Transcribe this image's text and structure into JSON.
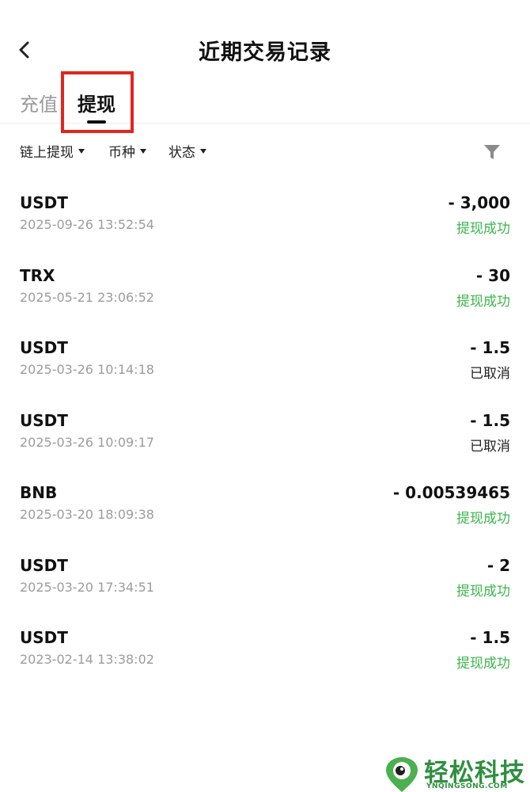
{
  "header": {
    "title": "近期交易记录"
  },
  "tabs": [
    {
      "label": "充值"
    },
    {
      "label": "提现"
    }
  ],
  "filters": [
    {
      "label": "链上提现"
    },
    {
      "label": "币种"
    },
    {
      "label": "状态"
    }
  ],
  "records": [
    {
      "coin": "USDT",
      "time": "2025-09-26 13:52:54",
      "amount": "- 3,000",
      "status": "提现成功"
    },
    {
      "coin": "TRX",
      "time": "2025-05-21 23:06:52",
      "amount": "- 30",
      "status": "提现成功"
    },
    {
      "coin": "USDT",
      "time": "2025-03-26 10:14:18",
      "amount": "- 1.5",
      "status": "已取消"
    },
    {
      "coin": "USDT",
      "time": "2025-03-26 10:09:17",
      "amount": "- 1.5",
      "status": "已取消"
    },
    {
      "coin": "BNB",
      "time": "2025-03-20 18:09:38",
      "amount": "- 0.00539465",
      "status": "提现成功"
    },
    {
      "coin": "USDT",
      "time": "2025-03-20 17:34:51",
      "amount": "- 2",
      "status": "提现成功"
    },
    {
      "coin": "USDT",
      "time": "2023-02-14 13:38:02",
      "amount": "- 1.5",
      "status": "提现成功"
    }
  ],
  "watermark": {
    "title": "轻松科技",
    "subtitle": "YNQINGSONG.COM"
  },
  "colors": {
    "success": "#3bb54a",
    "highlight": "#e0261d",
    "muted": "#9c9c9c"
  }
}
